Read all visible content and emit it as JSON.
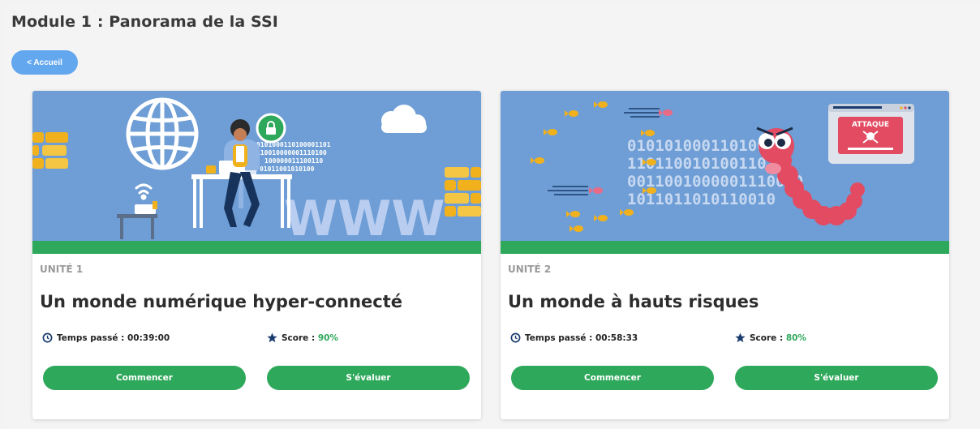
{
  "page": {
    "title": "Module 1 : Panorama de la SSI",
    "back_label": "< Accueil"
  },
  "banner_text": {
    "binary1": [
      "0101000110100001101",
      "110010000001110100",
      "100000011100110",
      "01011001010100"
    ],
    "www": "WWW",
    "binary2": [
      "0101010001101000",
      "110110010100110101",
      "0011001000001110010",
      "1011011010110010"
    ],
    "attack_label": "ATTAQUE"
  },
  "cards": [
    {
      "unit": "UNITÉ 1",
      "title": "Un monde numérique hyper-connecté",
      "time_label": "Temps passé : 00:39:00",
      "score_label": "Score : ",
      "score_value": "90%",
      "start_label": "Commencer",
      "eval_label": "S'évaluer"
    },
    {
      "unit": "UNITÉ 2",
      "title": "Un monde à hauts risques",
      "time_label": "Temps passé : 00:58:33",
      "score_label": "Score : ",
      "score_value": "80%",
      "start_label": "Commencer",
      "eval_label": "S'évaluer"
    }
  ],
  "icons": {
    "clock": "clock-icon",
    "star": "star-icon",
    "globe": "globe-icon",
    "lock": "lock-icon",
    "wifi": "wifi-icon",
    "cloud": "cloud-icon",
    "worm": "worm-icon",
    "skull": "skull-icon",
    "fish": "fish-icon"
  },
  "colors": {
    "accent_blue": "#63a7ee",
    "green": "#2ea85a",
    "banner_blue": "#6e9ed5",
    "worm_red": "#e24b62"
  }
}
